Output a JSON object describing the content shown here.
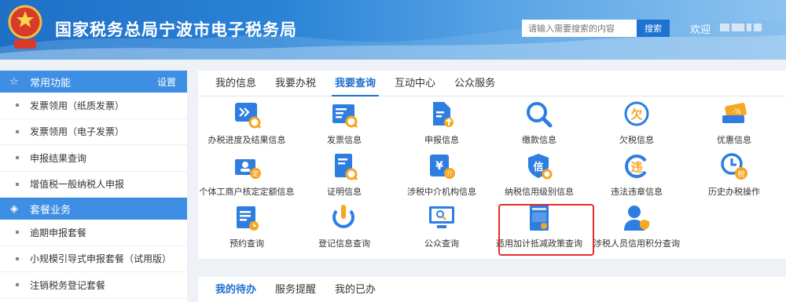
{
  "header": {
    "site_title": "国家税务总局宁波市电子税务局",
    "search_placeholder": "请输入需要搜索的内容",
    "search_button": "搜索",
    "welcome": "欢迎"
  },
  "sidebar": {
    "sections": [
      {
        "title": "常用功能",
        "icon": "star-icon",
        "action": "设置",
        "items": [
          "发票领用（纸质发票）",
          "发票领用（电子发票）",
          "申报结果查询",
          "增值税一般纳税人申报"
        ]
      },
      {
        "title": "套餐业务",
        "icon": "layers-icon",
        "items": [
          "逾期申报套餐",
          "小规模引导式申报套餐（试用版）",
          "注销税务登记套餐"
        ]
      }
    ]
  },
  "main_tabs": [
    "我的信息",
    "我要办税",
    "我要查询",
    "互动中心",
    "公众服务"
  ],
  "main_tabs_active": 2,
  "query_items": [
    {
      "label": "办税进度及结果信息",
      "icon": "progress-icon"
    },
    {
      "label": "发票信息",
      "icon": "invoice-icon"
    },
    {
      "label": "申报信息",
      "icon": "declare-icon"
    },
    {
      "label": "缴款信息",
      "icon": "search-icon"
    },
    {
      "label": "欠税信息",
      "icon": "owed-tax-icon"
    },
    {
      "label": "优惠信息",
      "icon": "discount-icon"
    },
    {
      "label": "个体工商户核定定额信息",
      "icon": "business-quota-icon"
    },
    {
      "label": "证明信息",
      "icon": "certificate-icon"
    },
    {
      "label": "涉税中介机构信息",
      "icon": "agency-icon"
    },
    {
      "label": "纳税信用级别信息",
      "icon": "credit-icon"
    },
    {
      "label": "违法违章信息",
      "icon": "violation-icon"
    },
    {
      "label": "历史办税操作",
      "icon": "history-icon"
    },
    {
      "label": "预约查询",
      "icon": "appointment-icon"
    },
    {
      "label": "登记信息查询",
      "icon": "registration-icon"
    },
    {
      "label": "公众查询",
      "icon": "public-query-icon"
    },
    {
      "label": "适用加计抵减政策查询",
      "icon": "policy-document-icon"
    },
    {
      "label": "涉税人员信用积分查询",
      "icon": "personnel-credit-icon"
    }
  ],
  "icon_glyphs": {
    "owed": "欠",
    "violation": "违",
    "credit": "信",
    "history": "税",
    "yuan": "¥",
    "jie": "介",
    "ding": "定",
    "discount": "-%"
  },
  "bottom_tabs": [
    "我的待办",
    "服务提醒",
    "我的已办"
  ],
  "bottom_tabs_active": 0,
  "colors": {
    "brand_blue": "#1f6fcf",
    "sidebar_head": "#3e8ee4",
    "icon_blue": "#2d7ee0",
    "icon_orange": "#f5a623",
    "highlight_red": "#e02c2c"
  }
}
